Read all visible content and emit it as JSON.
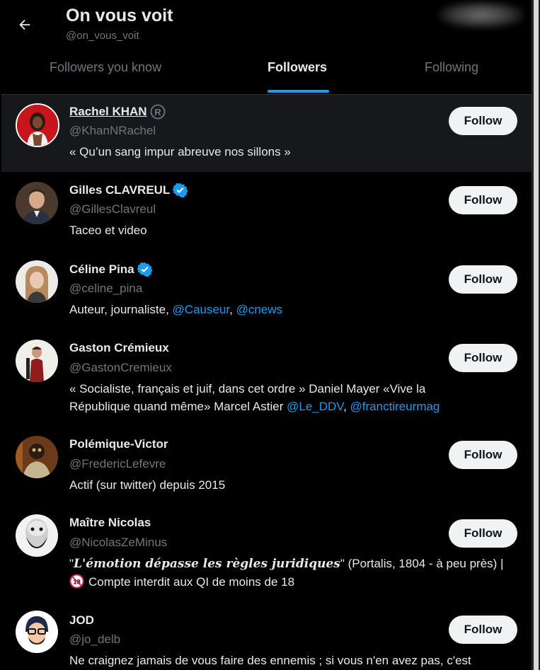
{
  "header": {
    "title": "On vous voit",
    "handle": "@on_vous_voit",
    "tabs": [
      {
        "label": "Followers you know"
      },
      {
        "label": "Followers"
      },
      {
        "label": "Following"
      }
    ]
  },
  "accent_color": "#1d9bf0",
  "follow_label": "Follow",
  "users": [
    {
      "name": "Rachel KHAN",
      "handle": "@KhanNRachel",
      "bio": "« Qu’un sang impur abreuve nos sillons »"
    },
    {
      "name": "Gilles CLAVREUL",
      "handle": "@GillesClavreul",
      "bio": "Taceo et video"
    },
    {
      "name": "Céline Pina",
      "handle": "@celine_pina",
      "bio_prefix": "Auteur, journaliste, ",
      "link1": "@Causeur",
      "sep": ", ",
      "link2": "@cnews"
    },
    {
      "name": "Gaston Crémieux",
      "handle": "@GastonCremieux",
      "bio_line1": "« Socialiste, français et juif, dans cet ordre » Daniel Mayer «Vive la",
      "bio_line2_prefix": "République quand même» Marcel Astier ",
      "link1": "@Le_DDV",
      "sep": ", ",
      "link2": "@franctireurmag"
    },
    {
      "name": "Polémique-Victor",
      "handle": "@FredericLefevre",
      "bio": "Actif (sur twitter) depuis 2015"
    },
    {
      "name": "Maître Nicolas",
      "handle": "@NicolasZeMinus",
      "bio_open_quote": "\"",
      "bio_styled": "L'émotion dépasse les règles juridiques",
      "bio_rest": "\" (Portalis, 1804 - à peu près) |",
      "bio_line2": "Compte interdit aux QI de moins de 18"
    },
    {
      "name": "JOD",
      "handle": "@jo_delb",
      "bio": "Ne craignez jamais de vous faire des ennemis ; si vous n'en avez pas, c'est"
    }
  ]
}
